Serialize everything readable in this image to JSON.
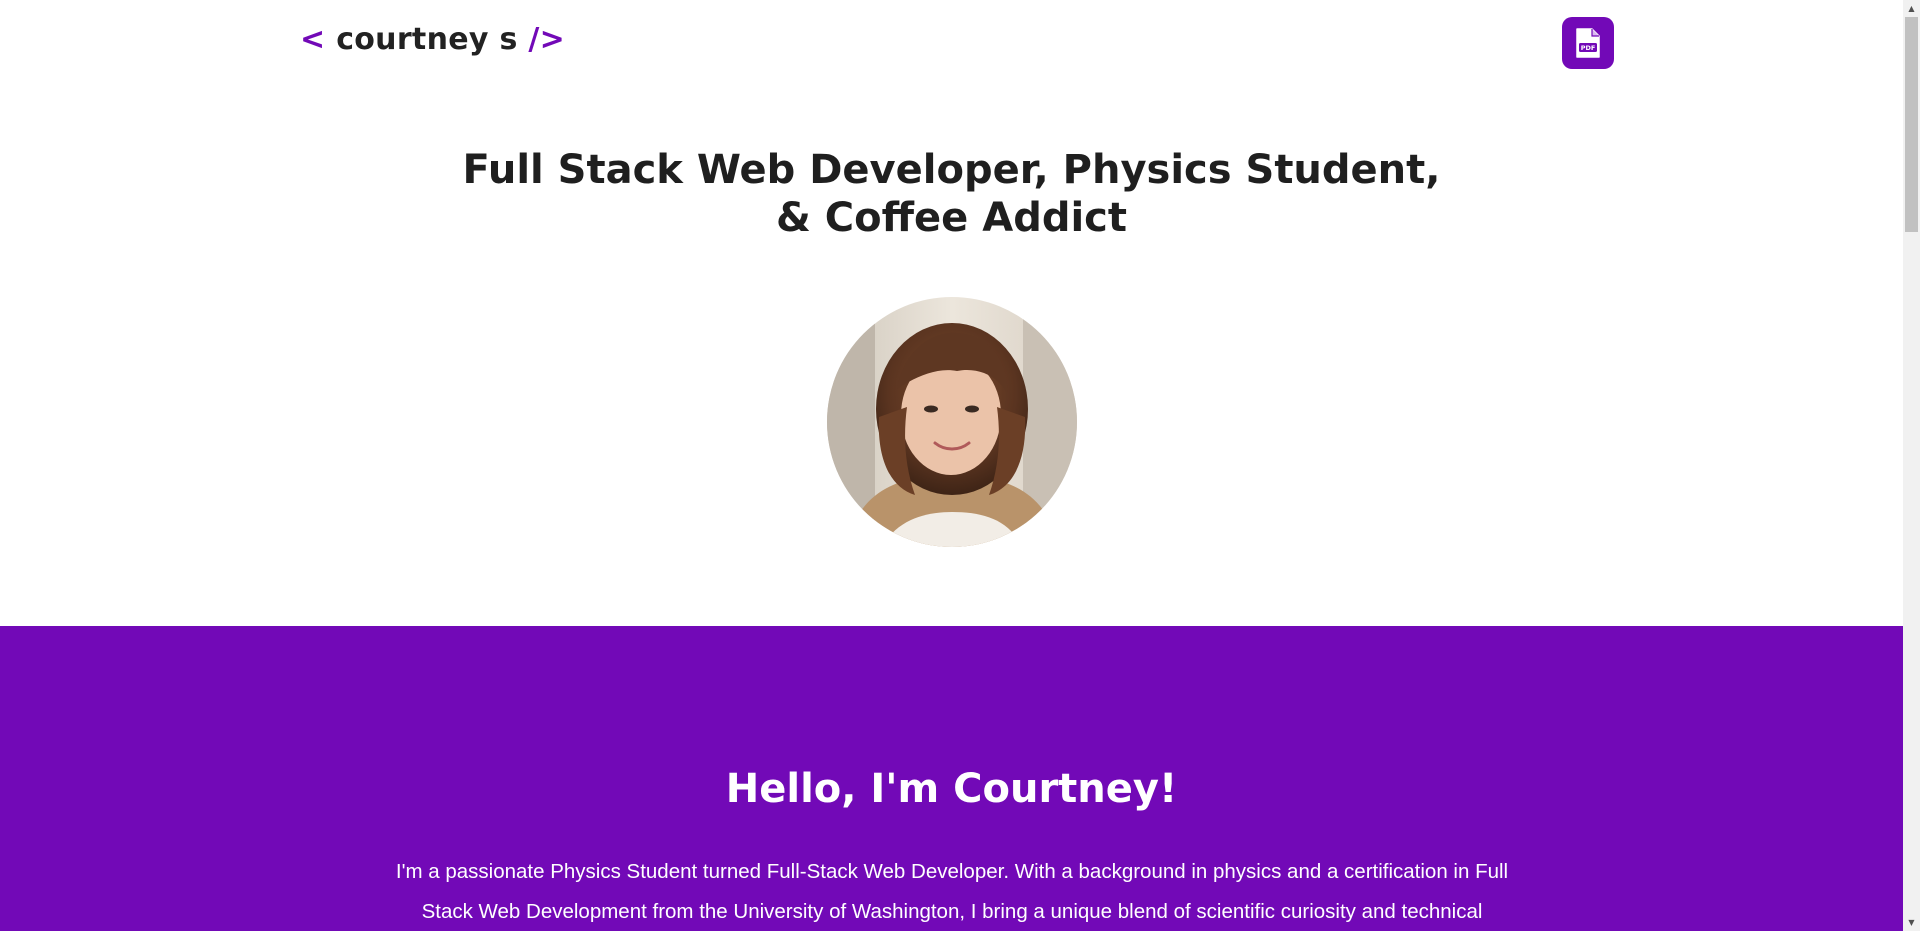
{
  "header": {
    "logo": {
      "open": "<",
      "name": "courtney s",
      "close": "/>"
    },
    "pdf_icon_label": "PDF"
  },
  "hero": {
    "title_line1": "Full Stack Web Developer, Physics Student,",
    "title_line2": "& Coffee Addict"
  },
  "about": {
    "heading": "Hello, I'm Courtney!",
    "intro": "I'm a passionate Physics Student turned Full-Stack Web Developer. With a background in physics and a certification in Full Stack Web Development from the University of Washington, I bring a unique blend of scientific curiosity and technical"
  },
  "colors": {
    "accent": "#7209b7",
    "text": "#222222",
    "background": "#ffffff"
  },
  "icons": [
    "pdf-file-icon",
    "profile-photo",
    "scroll-up-arrow-icon",
    "scroll-down-arrow-icon"
  ]
}
